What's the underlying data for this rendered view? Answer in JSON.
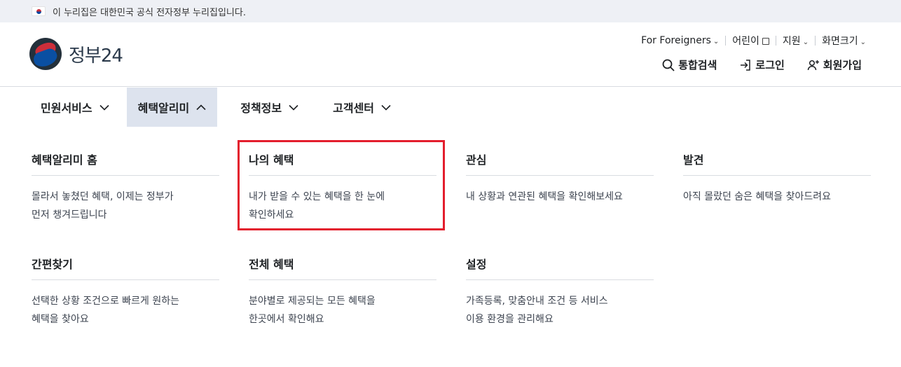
{
  "banner": {
    "text": "이 누리집은 대한민국 공식 전자정부 누리집입니다."
  },
  "logo": {
    "text": "정부24"
  },
  "util_links": [
    {
      "label": "For Foreigners"
    },
    {
      "label": "어린이"
    },
    {
      "label": "지원"
    },
    {
      "label": "화면크기"
    }
  ],
  "user_actions": {
    "search": "통합검색",
    "login": "로그인",
    "signup": "회원가입"
  },
  "gnb": [
    {
      "label": "민원서비스",
      "state": "collapsed"
    },
    {
      "label": "혜택알리미",
      "state": "expanded"
    },
    {
      "label": "정책정보",
      "state": "collapsed"
    },
    {
      "label": "고객센터",
      "state": "collapsed"
    }
  ],
  "submenu": [
    {
      "title": "혜택알리미 홈",
      "line1": "몰라서 놓쳤던 혜택, 이제는 정부가",
      "line2": "먼저 챙겨드립니다"
    },
    {
      "title": "나의 혜택",
      "line1": "내가 받을 수 있는 혜택을 한 눈에",
      "line2": "확인하세요"
    },
    {
      "title": "관심",
      "line1": "내 상황과 연관된 혜택을 확인해보세요",
      "line2": ""
    },
    {
      "title": "발견",
      "line1": "아직 몰랐던 숨은 혜택을 찾아드려요",
      "line2": ""
    },
    {
      "title": "간편찾기",
      "line1": "선택한 상황 조건으로 빠르게 원하는",
      "line2": "혜택을 찾아요"
    },
    {
      "title": "전체 혜택",
      "line1": "분야별로 제공되는 모든 혜택을",
      "line2": "한곳에서 확인해요"
    },
    {
      "title": "설정",
      "line1": "가족등록, 맞춤안내 조건 등 서비스",
      "line2": "이용 환경을 관리해요"
    }
  ],
  "colors": {
    "highlight_border": "#e31e2d",
    "active_menu_bg": "#dde3ee",
    "banner_bg": "#eef0f5"
  },
  "icons": {
    "search": "search-icon",
    "login": "login-icon",
    "signup": "user-plus-icon",
    "external": "external-link-icon",
    "chevron_down": "chevron-down-icon",
    "chevron_up": "chevron-up-icon"
  }
}
